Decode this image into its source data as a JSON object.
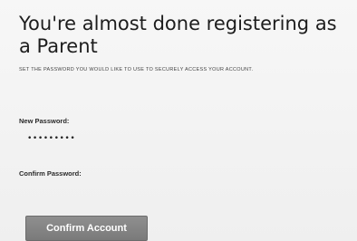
{
  "form": {
    "title": "You're almost done registering as a Parent",
    "instructions": "SET THE PASSWORD YOU WOULD LIKE TO USE TO SECURELY ACCESS YOUR ACCOUNT.",
    "new_password": {
      "label": "New Password:",
      "value": "•••••••••"
    },
    "confirm_password": {
      "label": "Confirm Password:",
      "value": ""
    },
    "submit_label": "Confirm Account"
  }
}
